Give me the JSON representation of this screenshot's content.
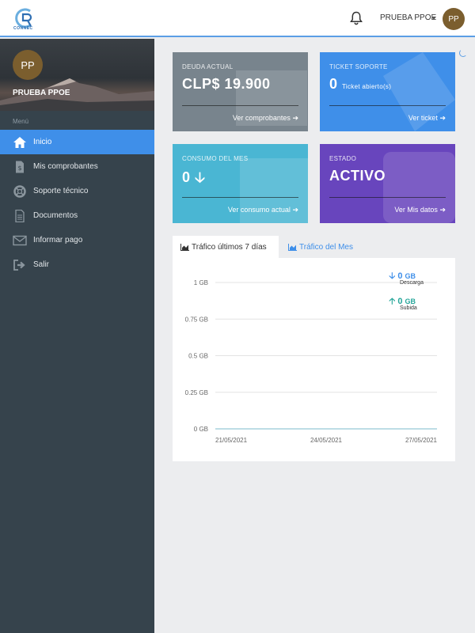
{
  "header": {
    "logo_text": "CONNEC",
    "user_name": "PRUEBA PPOE",
    "avatar_initials": "PP"
  },
  "sidebar": {
    "profile": {
      "initials": "PP",
      "name": "PRUEBA PPOE"
    },
    "menu_title": "Menú",
    "items": [
      {
        "label": "Inicio",
        "icon": "home-icon",
        "active": true
      },
      {
        "label": "Mis comprobantes",
        "icon": "invoice-icon",
        "active": false
      },
      {
        "label": "Soporte técnico",
        "icon": "lifebuoy-icon",
        "active": false
      },
      {
        "label": "Documentos",
        "icon": "document-icon",
        "active": false
      },
      {
        "label": "Informar pago",
        "icon": "envelope-icon",
        "active": false
      },
      {
        "label": "Salir",
        "icon": "sign-out-icon",
        "active": false
      }
    ]
  },
  "cards": {
    "deuda": {
      "label": "DEUDA ACTUAL",
      "value": "CLP$ 19.900",
      "link": "Ver comprobantes",
      "color": "#78848d"
    },
    "ticket": {
      "label": "TICKET SOPORTE",
      "value": "0",
      "sub": "Ticket abierto(s)",
      "link": "Ver ticket",
      "color": "#3f8fe9"
    },
    "consumo": {
      "label": "CONSUMO DEL MES",
      "value": "0",
      "link": "Ver consumo actual",
      "color": "#4ab6d3"
    },
    "estado": {
      "label": "ESTADO",
      "value": "ACTIVO",
      "link": "Ver Mis datos",
      "color": "#6845bd"
    }
  },
  "tabs": {
    "active_label": "Tráfico últimos 7 días",
    "inactive_label": "Tráfico del Mes"
  },
  "legend": {
    "download_value": "0",
    "download_unit": "GB",
    "download_label": "Descarga",
    "upload_value": "0",
    "upload_unit": "GB",
    "upload_label": "Subida",
    "download_color": "#3f8fe9",
    "upload_color": "#26a69a"
  },
  "chart_data": {
    "type": "line",
    "x": [
      "21/05/2021",
      "24/05/2021",
      "27/05/2021"
    ],
    "y_ticks": [
      "1 GB",
      "0.75 GB",
      "0.5 GB",
      "0.25 GB",
      "0 GB"
    ],
    "ylim": [
      0,
      1
    ],
    "series": [
      {
        "name": "Descarga",
        "values": [
          0,
          0,
          0
        ]
      },
      {
        "name": "Subida",
        "values": [
          0,
          0,
          0
        ]
      }
    ],
    "grid": true
  }
}
